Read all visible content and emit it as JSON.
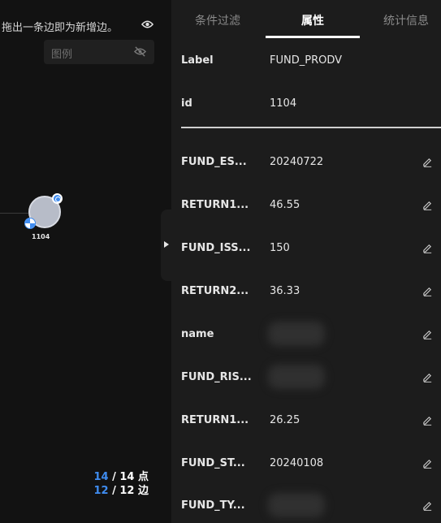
{
  "canvas": {
    "hint": "拖出一条边即为新增边。",
    "hint_icon": "eye-icon",
    "legend_label": "图例",
    "legend_icon": "eye-off-icon",
    "node": {
      "label": "1104",
      "top_badge_icon": "target-icon",
      "bottom_badge_icon": "ball-icon",
      "color": "#b7bcc8"
    },
    "counts": {
      "nodes_visible": "14",
      "nodes_total": "/ 14 点",
      "edges_visible": "12",
      "edges_total": "/ 12 边"
    }
  },
  "collapse_icon": "caret-right-icon",
  "tabs": [
    {
      "label": "条件过滤",
      "active": false
    },
    {
      "label": "属性",
      "active": true
    },
    {
      "label": "统计信息",
      "active": false
    }
  ],
  "fixed_attrs": [
    {
      "key": "Label",
      "value": "FUND_PRODV"
    },
    {
      "key": "id",
      "value": "1104"
    }
  ],
  "attrs": [
    {
      "key": "FUND_ES...",
      "value": "20240722",
      "obscured": false
    },
    {
      "key": "RETURN1...",
      "value": "46.55",
      "obscured": false
    },
    {
      "key": "FUND_ISS...",
      "value": "150",
      "obscured": false
    },
    {
      "key": "RETURN2...",
      "value": "36.33",
      "obscured": false
    },
    {
      "key": "name",
      "value": "",
      "obscured": true
    },
    {
      "key": "FUND_RIS...",
      "value": "",
      "obscured": true
    },
    {
      "key": "RETURN1...",
      "value": "26.25",
      "obscured": false
    },
    {
      "key": "FUND_ST...",
      "value": "20240108",
      "obscured": false
    },
    {
      "key": "FUND_TY...",
      "value": "",
      "obscured": true
    }
  ],
  "edit_icon": "pencil-icon",
  "colors": {
    "accent": "#3f8cf0",
    "panel_bg": "#1c1c1c",
    "canvas_bg": "#121212"
  }
}
